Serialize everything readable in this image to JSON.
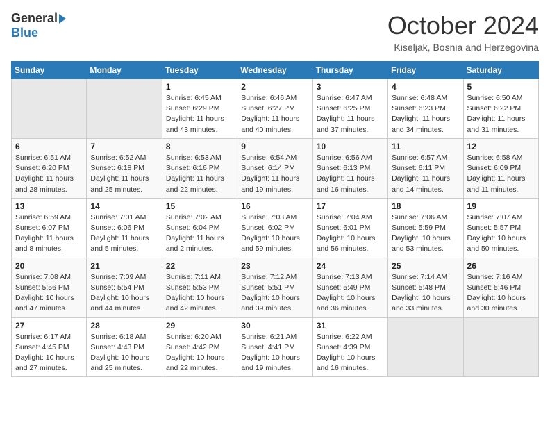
{
  "logo": {
    "general": "General",
    "blue": "Blue"
  },
  "title": "October 2024",
  "location": "Kiseljak, Bosnia and Herzegovina",
  "days_of_week": [
    "Sunday",
    "Monday",
    "Tuesday",
    "Wednesday",
    "Thursday",
    "Friday",
    "Saturday"
  ],
  "weeks": [
    [
      {
        "day": "",
        "empty": true
      },
      {
        "day": "",
        "empty": true
      },
      {
        "day": "1",
        "sunrise": "Sunrise: 6:45 AM",
        "sunset": "Sunset: 6:29 PM",
        "daylight": "Daylight: 11 hours and 43 minutes."
      },
      {
        "day": "2",
        "sunrise": "Sunrise: 6:46 AM",
        "sunset": "Sunset: 6:27 PM",
        "daylight": "Daylight: 11 hours and 40 minutes."
      },
      {
        "day": "3",
        "sunrise": "Sunrise: 6:47 AM",
        "sunset": "Sunset: 6:25 PM",
        "daylight": "Daylight: 11 hours and 37 minutes."
      },
      {
        "day": "4",
        "sunrise": "Sunrise: 6:48 AM",
        "sunset": "Sunset: 6:23 PM",
        "daylight": "Daylight: 11 hours and 34 minutes."
      },
      {
        "day": "5",
        "sunrise": "Sunrise: 6:50 AM",
        "sunset": "Sunset: 6:22 PM",
        "daylight": "Daylight: 11 hours and 31 minutes."
      }
    ],
    [
      {
        "day": "6",
        "sunrise": "Sunrise: 6:51 AM",
        "sunset": "Sunset: 6:20 PM",
        "daylight": "Daylight: 11 hours and 28 minutes."
      },
      {
        "day": "7",
        "sunrise": "Sunrise: 6:52 AM",
        "sunset": "Sunset: 6:18 PM",
        "daylight": "Daylight: 11 hours and 25 minutes."
      },
      {
        "day": "8",
        "sunrise": "Sunrise: 6:53 AM",
        "sunset": "Sunset: 6:16 PM",
        "daylight": "Daylight: 11 hours and 22 minutes."
      },
      {
        "day": "9",
        "sunrise": "Sunrise: 6:54 AM",
        "sunset": "Sunset: 6:14 PM",
        "daylight": "Daylight: 11 hours and 19 minutes."
      },
      {
        "day": "10",
        "sunrise": "Sunrise: 6:56 AM",
        "sunset": "Sunset: 6:13 PM",
        "daylight": "Daylight: 11 hours and 16 minutes."
      },
      {
        "day": "11",
        "sunrise": "Sunrise: 6:57 AM",
        "sunset": "Sunset: 6:11 PM",
        "daylight": "Daylight: 11 hours and 14 minutes."
      },
      {
        "day": "12",
        "sunrise": "Sunrise: 6:58 AM",
        "sunset": "Sunset: 6:09 PM",
        "daylight": "Daylight: 11 hours and 11 minutes."
      }
    ],
    [
      {
        "day": "13",
        "sunrise": "Sunrise: 6:59 AM",
        "sunset": "Sunset: 6:07 PM",
        "daylight": "Daylight: 11 hours and 8 minutes."
      },
      {
        "day": "14",
        "sunrise": "Sunrise: 7:01 AM",
        "sunset": "Sunset: 6:06 PM",
        "daylight": "Daylight: 11 hours and 5 minutes."
      },
      {
        "day": "15",
        "sunrise": "Sunrise: 7:02 AM",
        "sunset": "Sunset: 6:04 PM",
        "daylight": "Daylight: 11 hours and 2 minutes."
      },
      {
        "day": "16",
        "sunrise": "Sunrise: 7:03 AM",
        "sunset": "Sunset: 6:02 PM",
        "daylight": "Daylight: 10 hours and 59 minutes."
      },
      {
        "day": "17",
        "sunrise": "Sunrise: 7:04 AM",
        "sunset": "Sunset: 6:01 PM",
        "daylight": "Daylight: 10 hours and 56 minutes."
      },
      {
        "day": "18",
        "sunrise": "Sunrise: 7:06 AM",
        "sunset": "Sunset: 5:59 PM",
        "daylight": "Daylight: 10 hours and 53 minutes."
      },
      {
        "day": "19",
        "sunrise": "Sunrise: 7:07 AM",
        "sunset": "Sunset: 5:57 PM",
        "daylight": "Daylight: 10 hours and 50 minutes."
      }
    ],
    [
      {
        "day": "20",
        "sunrise": "Sunrise: 7:08 AM",
        "sunset": "Sunset: 5:56 PM",
        "daylight": "Daylight: 10 hours and 47 minutes."
      },
      {
        "day": "21",
        "sunrise": "Sunrise: 7:09 AM",
        "sunset": "Sunset: 5:54 PM",
        "daylight": "Daylight: 10 hours and 44 minutes."
      },
      {
        "day": "22",
        "sunrise": "Sunrise: 7:11 AM",
        "sunset": "Sunset: 5:53 PM",
        "daylight": "Daylight: 10 hours and 42 minutes."
      },
      {
        "day": "23",
        "sunrise": "Sunrise: 7:12 AM",
        "sunset": "Sunset: 5:51 PM",
        "daylight": "Daylight: 10 hours and 39 minutes."
      },
      {
        "day": "24",
        "sunrise": "Sunrise: 7:13 AM",
        "sunset": "Sunset: 5:49 PM",
        "daylight": "Daylight: 10 hours and 36 minutes."
      },
      {
        "day": "25",
        "sunrise": "Sunrise: 7:14 AM",
        "sunset": "Sunset: 5:48 PM",
        "daylight": "Daylight: 10 hours and 33 minutes."
      },
      {
        "day": "26",
        "sunrise": "Sunrise: 7:16 AM",
        "sunset": "Sunset: 5:46 PM",
        "daylight": "Daylight: 10 hours and 30 minutes."
      }
    ],
    [
      {
        "day": "27",
        "sunrise": "Sunrise: 6:17 AM",
        "sunset": "Sunset: 4:45 PM",
        "daylight": "Daylight: 10 hours and 27 minutes."
      },
      {
        "day": "28",
        "sunrise": "Sunrise: 6:18 AM",
        "sunset": "Sunset: 4:43 PM",
        "daylight": "Daylight: 10 hours and 25 minutes."
      },
      {
        "day": "29",
        "sunrise": "Sunrise: 6:20 AM",
        "sunset": "Sunset: 4:42 PM",
        "daylight": "Daylight: 10 hours and 22 minutes."
      },
      {
        "day": "30",
        "sunrise": "Sunrise: 6:21 AM",
        "sunset": "Sunset: 4:41 PM",
        "daylight": "Daylight: 10 hours and 19 minutes."
      },
      {
        "day": "31",
        "sunrise": "Sunrise: 6:22 AM",
        "sunset": "Sunset: 4:39 PM",
        "daylight": "Daylight: 10 hours and 16 minutes."
      },
      {
        "day": "",
        "empty": true
      },
      {
        "day": "",
        "empty": true
      }
    ]
  ]
}
